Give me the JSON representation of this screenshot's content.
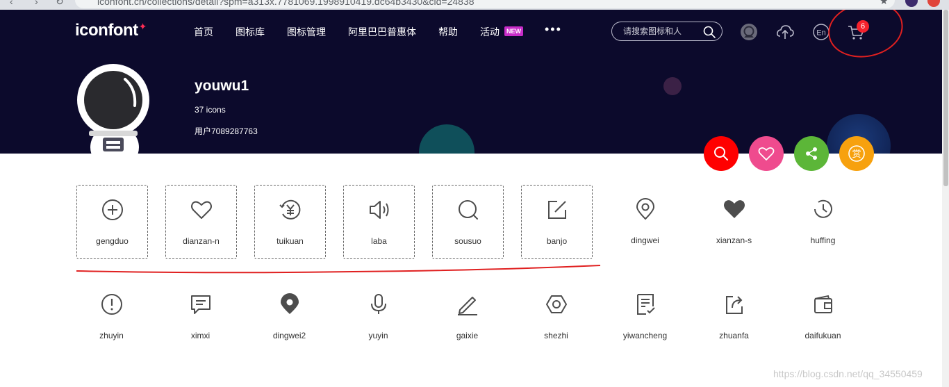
{
  "browser": {
    "url": "iconfont.cn/collections/detail?spm=a313x.7781069.1998910419.dc64b3430&cid=24838"
  },
  "header": {
    "logo": "iconfont",
    "nav": [
      "首页",
      "图标库",
      "图标管理",
      "阿里巴巴普惠体",
      "帮助",
      "活动"
    ],
    "new_badge": "NEW",
    "more": "•••",
    "search_placeholder": "请搜索图标和人",
    "cart_count": "6",
    "lang": "En"
  },
  "profile": {
    "name": "youwu1",
    "icon_count": "37 icons",
    "user_id": "用户7089287763"
  },
  "actions": [
    "search",
    "favorite",
    "share",
    "reward"
  ],
  "reward_glyph": "赏",
  "icons_row1": [
    {
      "name": "gengduo",
      "icon": "plus-circle-icon",
      "selected": true
    },
    {
      "name": "dianzan-n",
      "icon": "heart-outline-icon",
      "selected": true
    },
    {
      "name": "tuikuan",
      "icon": "yen-refund-icon",
      "selected": true
    },
    {
      "name": "laba",
      "icon": "speaker-icon",
      "selected": true
    },
    {
      "name": "sousuo",
      "icon": "search-icon",
      "selected": true
    },
    {
      "name": "banjo",
      "icon": "edit-square-icon",
      "selected": true
    },
    {
      "name": "dingwei",
      "icon": "location-outline-icon",
      "selected": false
    },
    {
      "name": "xianzan-s",
      "icon": "heart-filled-icon",
      "selected": false
    },
    {
      "name": "huffing",
      "icon": "clock-history-icon",
      "selected": false
    }
  ],
  "icons_row2": [
    {
      "name": "zhuyin",
      "icon": "alert-circle-icon"
    },
    {
      "name": "ximxi",
      "icon": "message-icon"
    },
    {
      "name": "dingwei2",
      "icon": "location-filled-icon"
    },
    {
      "name": "yuyin",
      "icon": "microphone-icon"
    },
    {
      "name": "gaixie",
      "icon": "pencil-icon"
    },
    {
      "name": "shezhi",
      "icon": "settings-hex-icon"
    },
    {
      "name": "yiwancheng",
      "icon": "document-check-icon"
    },
    {
      "name": "zhuanfa",
      "icon": "forward-icon"
    },
    {
      "name": "daifukuan",
      "icon": "wallet-icon"
    }
  ],
  "watermark": "https://blog.csdn.net/qq_34550459",
  "colors": {
    "header_bg": "#0c0a2c",
    "search_btn": "#ff0000",
    "favorite_btn": "#ef4b8e",
    "share_btn": "#5cb638",
    "reward_btn": "#f7a10e",
    "badge_red": "#f5222d",
    "new_badge": "#c82cc8",
    "annotation_red": "#e02020"
  }
}
